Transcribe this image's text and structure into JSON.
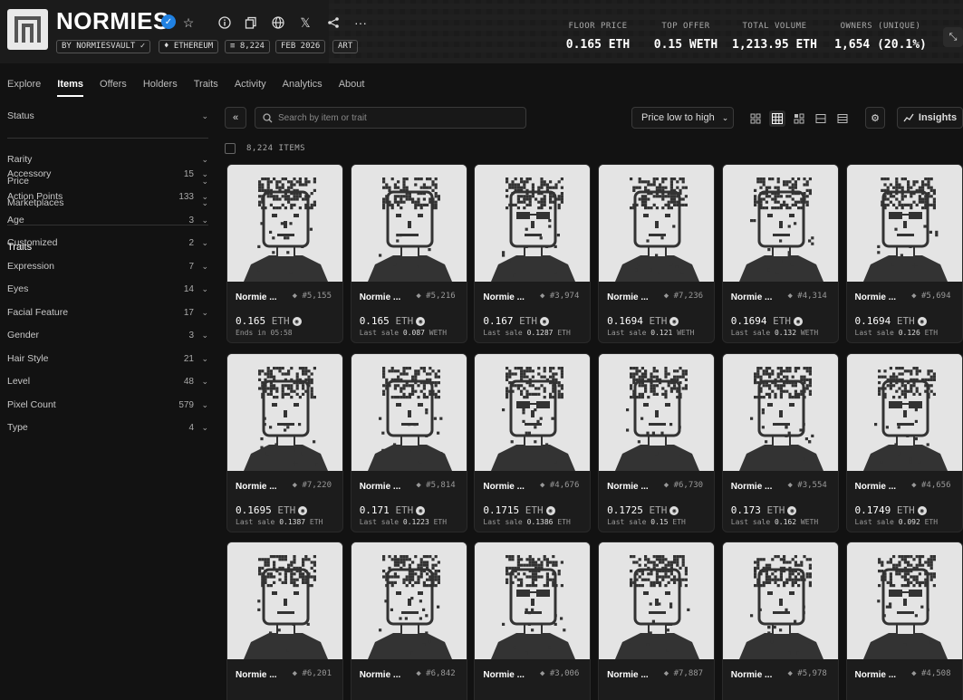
{
  "header": {
    "collection_name": "NORMIES",
    "chips": [
      "BY NORMIESVAULT",
      "ETHEREUM",
      "8,224",
      "FEB 2026",
      "ART"
    ],
    "stats": [
      {
        "label": "FLOOR PRICE",
        "value": "0.165 ETH"
      },
      {
        "label": "TOP OFFER",
        "value": "0.15 WETH"
      },
      {
        "label": "TOTAL VOLUME",
        "value": "1,213.95 ETH"
      },
      {
        "label": "OWNERS (UNIQUE)",
        "value": "1,654 (20.1%)"
      }
    ]
  },
  "nav": {
    "tabs": [
      "Explore",
      "Items",
      "Offers",
      "Holders",
      "Traits",
      "Activity",
      "Analytics",
      "About"
    ],
    "active": "Items"
  },
  "sidebar": {
    "status_label": "Status",
    "filters": [
      "Rarity",
      "Price",
      "Marketplaces"
    ],
    "traits_heading": "Traits",
    "traits": [
      {
        "name": "Accessory",
        "count": "15"
      },
      {
        "name": "Action Points",
        "count": "133"
      },
      {
        "name": "Age",
        "count": "3"
      },
      {
        "name": "Customized",
        "count": "2"
      },
      {
        "name": "Expression",
        "count": "7"
      },
      {
        "name": "Eyes",
        "count": "14"
      },
      {
        "name": "Facial Feature",
        "count": "17"
      },
      {
        "name": "Gender",
        "count": "3"
      },
      {
        "name": "Hair Style",
        "count": "21"
      },
      {
        "name": "Level",
        "count": "48"
      },
      {
        "name": "Pixel Count",
        "count": "579"
      },
      {
        "name": "Type",
        "count": "4"
      }
    ]
  },
  "toolbar": {
    "search_placeholder": "Search by item or trait",
    "sort_label": "Price low to high",
    "insights_label": "Insights"
  },
  "item_count": "8,224 ITEMS",
  "items": [
    {
      "name": "Normie ...",
      "id": "#5,155",
      "price": "0.165",
      "unit": "ETH",
      "sub_label": "Ends in 05:58",
      "sub_value": "",
      "sub_unit": ""
    },
    {
      "name": "Normie ...",
      "id": "#5,216",
      "price": "0.165",
      "unit": "ETH",
      "sub_label": "Last sale",
      "sub_value": "0.087",
      "sub_unit": "WETH"
    },
    {
      "name": "Normie ...",
      "id": "#3,974",
      "price": "0.167",
      "unit": "ETH",
      "sub_label": "Last sale",
      "sub_value": "0.1287",
      "sub_unit": "ETH"
    },
    {
      "name": "Normie ...",
      "id": "#7,236",
      "price": "0.1694",
      "unit": "ETH",
      "sub_label": "Last sale",
      "sub_value": "0.121",
      "sub_unit": "WETH"
    },
    {
      "name": "Normie ...",
      "id": "#4,314",
      "price": "0.1694",
      "unit": "ETH",
      "sub_label": "Last sale",
      "sub_value": "0.132",
      "sub_unit": "WETH"
    },
    {
      "name": "Normie ...",
      "id": "#5,694",
      "price": "0.1694",
      "unit": "ETH",
      "sub_label": "Last sale",
      "sub_value": "0.126",
      "sub_unit": "ETH"
    },
    {
      "name": "Normie ...",
      "id": "#7,220",
      "price": "0.1695",
      "unit": "ETH",
      "sub_label": "Last sale",
      "sub_value": "0.1387",
      "sub_unit": "ETH"
    },
    {
      "name": "Normie ...",
      "id": "#5,814",
      "price": "0.171",
      "unit": "ETH",
      "sub_label": "Last sale",
      "sub_value": "0.1223",
      "sub_unit": "ETH"
    },
    {
      "name": "Normie ...",
      "id": "#4,676",
      "price": "0.1715",
      "unit": "ETH",
      "sub_label": "Last sale",
      "sub_value": "0.1386",
      "sub_unit": "ETH"
    },
    {
      "name": "Normie ...",
      "id": "#6,730",
      "price": "0.1725",
      "unit": "ETH",
      "sub_label": "Last sale",
      "sub_value": "0.15",
      "sub_unit": "ETH"
    },
    {
      "name": "Normie ...",
      "id": "#3,554",
      "price": "0.173",
      "unit": "ETH",
      "sub_label": "Last sale",
      "sub_value": "0.162",
      "sub_unit": "WETH"
    },
    {
      "name": "Normie ...",
      "id": "#4,656",
      "price": "0.1749",
      "unit": "ETH",
      "sub_label": "Last sale",
      "sub_value": "0.092",
      "sub_unit": "ETH"
    },
    {
      "name": "Normie ...",
      "id": "#6,201",
      "price": "",
      "unit": "",
      "sub_label": "",
      "sub_value": "",
      "sub_unit": ""
    },
    {
      "name": "Normie ...",
      "id": "#6,842",
      "price": "",
      "unit": "",
      "sub_label": "",
      "sub_value": "",
      "sub_unit": ""
    },
    {
      "name": "Normie ...",
      "id": "#3,006",
      "price": "",
      "unit": "",
      "sub_label": "",
      "sub_value": "",
      "sub_unit": ""
    },
    {
      "name": "Normie ...",
      "id": "#7,887",
      "price": "",
      "unit": "",
      "sub_label": "",
      "sub_value": "",
      "sub_unit": ""
    },
    {
      "name": "Normie ...",
      "id": "#5,978",
      "price": "",
      "unit": "",
      "sub_label": "",
      "sub_value": "",
      "sub_unit": ""
    },
    {
      "name": "Normie ...",
      "id": "#4,508",
      "price": "",
      "unit": "",
      "sub_label": "",
      "sub_value": "",
      "sub_unit": ""
    }
  ]
}
